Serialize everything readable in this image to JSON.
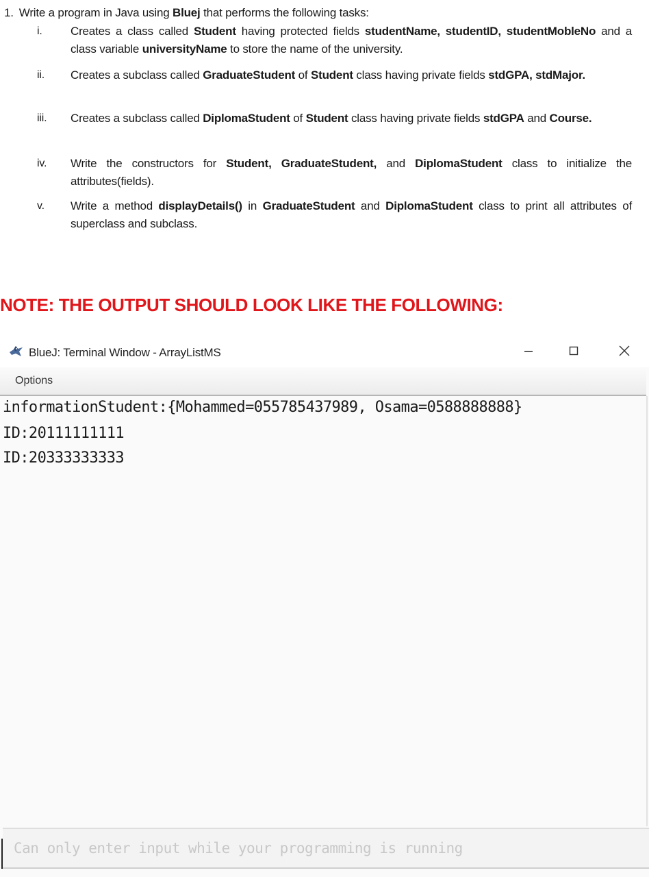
{
  "assignment": {
    "number": "1.",
    "heading_parts": [
      {
        "text": "Write a program in Java using ",
        "bold": false
      },
      {
        "text": "Bluej",
        "bold": true
      },
      {
        "text": " that performs the following tasks:",
        "bold": false
      }
    ],
    "items": [
      {
        "roman": "i.",
        "parts": [
          {
            "text": "Creates a class called ",
            "bold": false
          },
          {
            "text": "Student",
            "bold": true
          },
          {
            "text": " having protected fields ",
            "bold": false
          },
          {
            "text": "studentName, studentID, studentMobleNo",
            "bold": true
          },
          {
            "text": " and a class variable ",
            "bold": false
          },
          {
            "text": "universityName",
            "bold": true
          },
          {
            "text": " to store the name of the university.",
            "bold": false
          }
        ]
      },
      {
        "roman": "ii.",
        "parts": [
          {
            "text": "Creates a subclass called ",
            "bold": false
          },
          {
            "text": "GraduateStudent",
            "bold": true
          },
          {
            "text": " of ",
            "bold": false
          },
          {
            "text": "Student",
            "bold": true
          },
          {
            "text": " class having private fields ",
            "bold": false
          },
          {
            "text": "stdGPA, stdMajor.",
            "bold": true
          }
        ]
      },
      {
        "roman": "iii.",
        "parts": [
          {
            "text": "Creates a subclass called ",
            "bold": false
          },
          {
            "text": "DiplomaStudent",
            "bold": true
          },
          {
            "text": " of ",
            "bold": false
          },
          {
            "text": "Student",
            "bold": true
          },
          {
            "text": " class having private fields ",
            "bold": false
          },
          {
            "text": "stdGPA",
            "bold": true
          },
          {
            "text": " and ",
            "bold": false
          },
          {
            "text": "Course.",
            "bold": true
          }
        ]
      },
      {
        "roman": "iv.",
        "parts": [
          {
            "text": "Write the constructors for ",
            "bold": false
          },
          {
            "text": "Student, GraduateStudent,",
            "bold": true
          },
          {
            "text": " and ",
            "bold": false
          },
          {
            "text": "DiplomaStudent",
            "bold": true
          },
          {
            "text": " class to initialize the attributes(fields).",
            "bold": false
          }
        ]
      },
      {
        "roman": "v.",
        "parts": [
          {
            "text": "Write a method ",
            "bold": false
          },
          {
            "text": "displayDetails()",
            "bold": true
          },
          {
            "text": "  in ",
            "bold": false
          },
          {
            "text": "GraduateStudent",
            "bold": true
          },
          {
            "text": " and ",
            "bold": false
          },
          {
            "text": "DiplomaStudent",
            "bold": true
          },
          {
            "text": " class to print all attributes of superclass and subclass.",
            "bold": false
          }
        ]
      }
    ]
  },
  "note": {
    "text": "NOTE: THE OUTPUT SHOULD LOOK LIKE THE FOLLOWING:",
    "color": "#e0161b"
  },
  "terminal": {
    "icon": "bluej-bird-icon",
    "title": "BlueJ: Terminal Window - ArrayListMS",
    "controls": {
      "minimize": "minimize-icon",
      "maximize": "maximize-icon",
      "close": "close-icon"
    },
    "menu": {
      "options_label": "Options"
    },
    "output_lines": [
      "informationStudent:{Mohammed=055785437989, Osama=0588888888}",
      "ID:20111111111",
      "ID:20333333333"
    ],
    "input": {
      "value": "",
      "placeholder": "Can only enter input while your programming is running"
    }
  }
}
